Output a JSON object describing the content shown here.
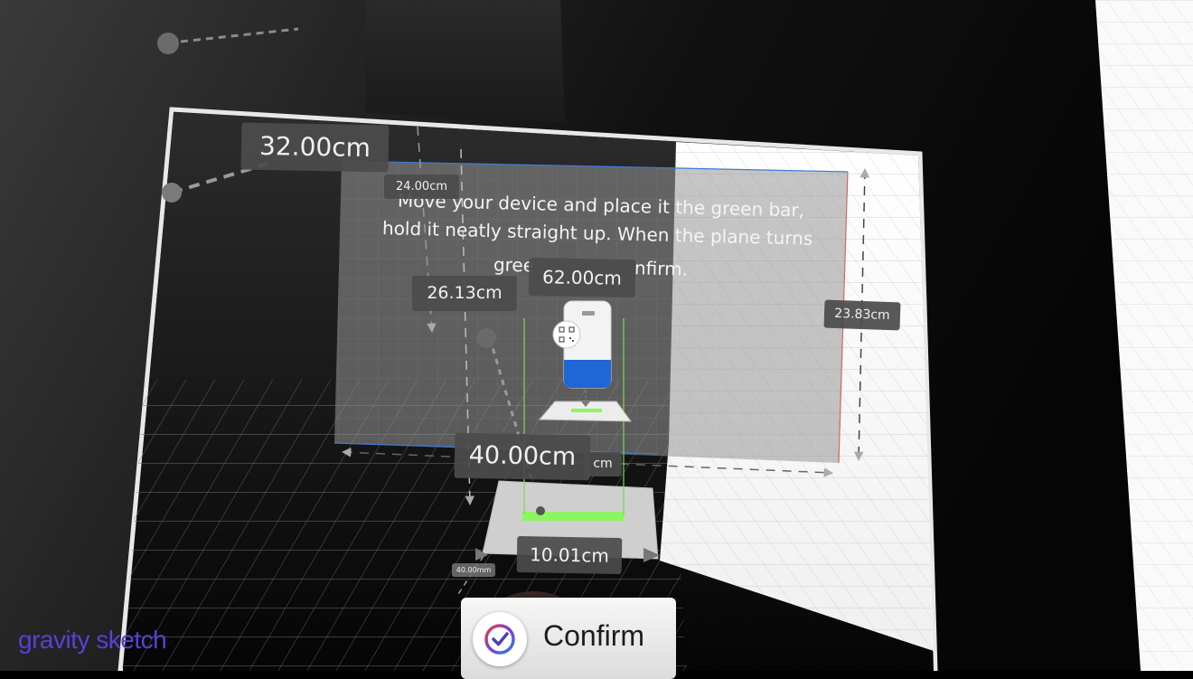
{
  "instruction": {
    "line1": "Move your device and place it the green bar,",
    "line2": "hold it neatly straight up. When the plane turns",
    "line3a": "gree",
    "line3b": "nfirm."
  },
  "measurements": {
    "width_top": "32.00cm",
    "small_top": "24.00cm",
    "height_left": "26.13cm",
    "center": "62.00cm",
    "right_height": "23.83cm",
    "depth": "40.00cm",
    "partial": "cm",
    "base": "10.01cm",
    "tiny": "40.00mm"
  },
  "confirm_button": {
    "label": "Confirm",
    "icon": "check-circle-icon"
  },
  "branding": {
    "watermark": "gravity sketch",
    "color": "#5a3fd6"
  },
  "colors": {
    "accent_green": "#8cf562",
    "plane_blue_edge": "#3d7bd9",
    "plane_red_edge": "#d04a4a"
  }
}
